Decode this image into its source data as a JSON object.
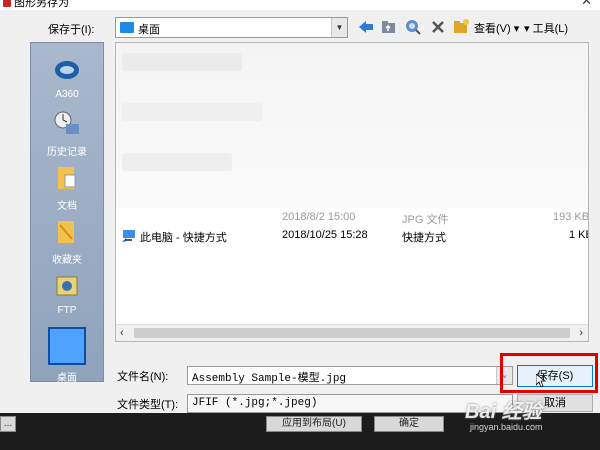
{
  "window": {
    "title": "图形另存为"
  },
  "save_in": {
    "label": "保存于(I):",
    "location": "桌面"
  },
  "toolbar": {
    "view_label": "查看(V)",
    "tools_label": "工具(L)",
    "icons": [
      "back-arrow-icon",
      "up-folder-icon",
      "search-web-icon",
      "delete-icon",
      "new-folder-icon"
    ]
  },
  "sidebar": {
    "items": [
      {
        "label": "A360",
        "icon": "a360-icon"
      },
      {
        "label": "历史记录",
        "icon": "history-icon"
      },
      {
        "label": "文档",
        "icon": "documents-icon"
      },
      {
        "label": "收藏夹",
        "icon": "favorites-icon"
      },
      {
        "label": "FTP",
        "icon": "ftp-icon"
      },
      {
        "label": "桌面",
        "icon": "desktop-icon"
      }
    ]
  },
  "files": {
    "rows": [
      {
        "name": "",
        "date": "2018/8/2 15:00",
        "type": "JPG 文件",
        "size": "193 KB",
        "faded": true
      },
      {
        "name": "此电脑 - 快捷方式",
        "date": "2018/10/25 15:28",
        "type": "快捷方式",
        "size": "1 KB",
        "faded": false
      }
    ]
  },
  "filename": {
    "label": "文件名(N):",
    "value": "Assembly Sample-模型.jpg"
  },
  "filetype": {
    "label": "文件类型(T):",
    "value": "JFIF (*.jpg;*.jpeg)"
  },
  "buttons": {
    "save": "保存(S)",
    "cancel": "取消"
  },
  "taskbar": {
    "left_btn": "...",
    "apply_btn": "应用到布局(U)",
    "ok_btn": "确定"
  },
  "watermark": {
    "brand": "Bai 经验",
    "url": "jingyan.baidu.com"
  },
  "colors": {
    "accent": "#0078d7",
    "highlight": "#e00000",
    "sidebar": "#9eb0c7"
  }
}
